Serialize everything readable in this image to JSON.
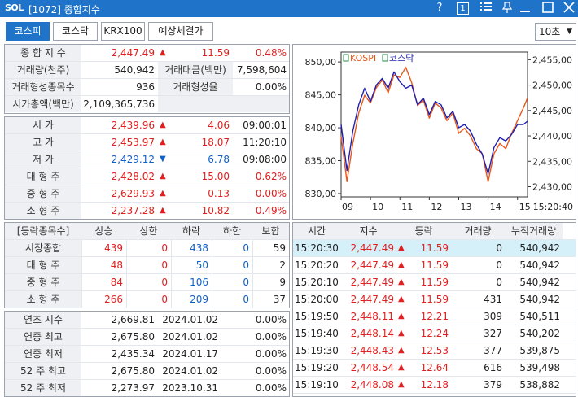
{
  "window": {
    "logo": "SOL",
    "title": "[1072] 종합지수",
    "help": "?",
    "box_label": "1"
  },
  "tabs": [
    {
      "label": "코스피",
      "active": true
    },
    {
      "label": "코스닥",
      "active": false
    },
    {
      "label": "KRX100",
      "active": false
    },
    {
      "label": "예상체결가",
      "active": false
    }
  ],
  "interval": {
    "value": "10초"
  },
  "summary": {
    "index_label": "종 합 지 수",
    "index_value": "2,447.49",
    "index_change": "11.59",
    "index_rate": "0.48%",
    "volume_label": "거래량(천주)",
    "volume_value": "540,942",
    "amount_label": "거래대금(백만)",
    "amount_value": "7,598,604",
    "formed_count_label": "거래형성종목수",
    "formed_count_value": "936",
    "formed_rate_label": "거래형성율",
    "formed_rate_value": "0.00%",
    "mcap_label": "시가총액(백만)",
    "mcap_value": "2,109,365,736"
  },
  "ohlc": [
    {
      "label": "시      가",
      "value": "2,439.96",
      "dir": "up",
      "change": "4.06",
      "extra": "09:00:01",
      "color": "red"
    },
    {
      "label": "고      가",
      "value": "2,453.97",
      "dir": "up",
      "change": "18.07",
      "extra": "11:20:10",
      "color": "red"
    },
    {
      "label": "저      가",
      "value": "2,429.12",
      "dir": "down",
      "change": "6.78",
      "extra": "09:08:00",
      "color": "blue"
    },
    {
      "label": "대 형 주",
      "value": "2,428.02",
      "dir": "up",
      "change": "15.00",
      "extra": "0.62%",
      "color": "red"
    },
    {
      "label": "중 형 주",
      "value": "2,629.93",
      "dir": "up",
      "change": "0.13",
      "extra": "0.00%",
      "color": "red"
    },
    {
      "label": "소 형 주",
      "value": "2,237.28",
      "dir": "up",
      "change": "10.82",
      "extra": "0.49%",
      "color": "red"
    }
  ],
  "breadth": {
    "headers": [
      "[등락종목수]",
      "상승",
      "상한",
      "하락",
      "하한",
      "보합"
    ],
    "rows": [
      {
        "label": "시장종합",
        "cells": [
          "439",
          "0",
          "438",
          "0",
          "59"
        ]
      },
      {
        "label": "대 형 주",
        "cells": [
          "48",
          "0",
          "50",
          "0",
          "2"
        ]
      },
      {
        "label": "중 형 주",
        "cells": [
          "84",
          "0",
          "106",
          "0",
          "9"
        ]
      },
      {
        "label": "소 형 주",
        "cells": [
          "266",
          "0",
          "209",
          "0",
          "37"
        ]
      }
    ]
  },
  "yearly": [
    {
      "label": "연초  지수",
      "value": "2,669.81",
      "date": "2024.01.02",
      "rate": "0.00%"
    },
    {
      "label": "연중  최고",
      "value": "2,675.80",
      "date": "2024.01.02",
      "rate": "0.00%"
    },
    {
      "label": "연중  최저",
      "value": "2,435.34",
      "date": "2024.01.17",
      "rate": "0.00%"
    },
    {
      "label": "52 주 최고",
      "value": "2,675.80",
      "date": "2024.01.02",
      "rate": "0.00%"
    },
    {
      "label": "52 주 최저",
      "value": "2,273.97",
      "date": "2023.10.31",
      "rate": "0.00%"
    }
  ],
  "ticks": {
    "headers": [
      "시간",
      "지수",
      "등락",
      "거래량",
      "누적거래량"
    ],
    "rows": [
      {
        "time": "15:20:30",
        "index": "2,447.49",
        "change": "11.59",
        "volume": "0",
        "cum": "540,942",
        "selected": true
      },
      {
        "time": "15:20:20",
        "index": "2,447.49",
        "change": "11.59",
        "volume": "0",
        "cum": "540,942",
        "selected": false
      },
      {
        "time": "15:20:10",
        "index": "2,447.49",
        "change": "11.59",
        "volume": "0",
        "cum": "540,942",
        "selected": false
      },
      {
        "time": "15:20:00",
        "index": "2,447.49",
        "change": "11.59",
        "volume": "431",
        "cum": "540,942",
        "selected": false
      },
      {
        "time": "15:19:50",
        "index": "2,448.11",
        "change": "12.21",
        "volume": "309",
        "cum": "540,511",
        "selected": false
      },
      {
        "time": "15:19:40",
        "index": "2,448.14",
        "change": "12.24",
        "volume": "327",
        "cum": "540,202",
        "selected": false
      },
      {
        "time": "15:19:30",
        "index": "2,448.43",
        "change": "12.53",
        "volume": "377",
        "cum": "539,875",
        "selected": false
      },
      {
        "time": "15:19:20",
        "index": "2,448.54",
        "change": "12.64",
        "volume": "616",
        "cum": "539,498",
        "selected": false
      },
      {
        "time": "15:19:10",
        "index": "2,448.08",
        "change": "12.18",
        "volume": "379",
        "cum": "538,882",
        "selected": false
      }
    ]
  },
  "chart_data": {
    "type": "line",
    "title": "",
    "series": [
      {
        "name": "KOSPI",
        "color": "#e8581a",
        "axis": "right",
        "x": [
          9.0,
          9.2,
          9.4,
          9.6,
          9.8,
          10.0,
          10.2,
          10.4,
          10.6,
          10.8,
          11.0,
          11.2,
          11.4,
          11.6,
          11.8,
          12.0,
          12.2,
          12.4,
          12.6,
          12.8,
          13.0,
          13.2,
          13.4,
          13.6,
          13.8,
          14.0,
          14.2,
          14.4,
          14.6,
          14.8,
          15.0,
          15.2,
          15.34
        ],
        "y": [
          2439.96,
          2431.0,
          2438.5,
          2444.5,
          2448.0,
          2446.5,
          2449.5,
          2451.0,
          2448.5,
          2452.0,
          2451.5,
          2453.5,
          2450.5,
          2446.0,
          2447.0,
          2443.5,
          2446.5,
          2445.5,
          2443.0,
          2444.5,
          2440.5,
          2441.5,
          2440.0,
          2437.5,
          2436.5,
          2431.0,
          2436.5,
          2438.5,
          2437.5,
          2440.5,
          2443.0,
          2445.5,
          2447.49
        ]
      },
      {
        "name": "코스닥",
        "color": "#2020b0",
        "axis": "left",
        "x": [
          9.0,
          9.2,
          9.4,
          9.6,
          9.8,
          10.0,
          10.2,
          10.4,
          10.6,
          10.8,
          11.0,
          11.2,
          11.4,
          11.6,
          11.8,
          12.0,
          12.2,
          12.4,
          12.6,
          12.8,
          13.0,
          13.2,
          13.4,
          13.6,
          13.8,
          14.0,
          14.2,
          14.4,
          14.6,
          14.8,
          15.0,
          15.2,
          15.34
        ],
        "y": [
          840.5,
          833.5,
          839.5,
          843.5,
          846.0,
          844.0,
          846.5,
          847.5,
          846.0,
          848.5,
          847.0,
          846.0,
          846.5,
          843.5,
          844.5,
          842.0,
          844.0,
          843.5,
          841.5,
          842.5,
          840.0,
          840.5,
          839.5,
          837.5,
          836.0,
          833.0,
          837.0,
          838.5,
          838.0,
          839.0,
          840.5,
          840.5,
          841.0
        ]
      }
    ],
    "y_left": {
      "ticks": [
        "850,00",
        "845,00",
        "840,00",
        "835,00",
        "830,00"
      ],
      "range": [
        829.5,
        851.5
      ]
    },
    "y_right": {
      "ticks": [
        "2,455,00",
        "2,450,00",
        "2,445,00",
        "2,440,00",
        "2,435,00",
        "2,430,00"
      ],
      "range": [
        2428.0,
        2456.5
      ]
    },
    "x_axis": {
      "ticks": [
        "09",
        "10",
        "11",
        "12",
        "13",
        "14",
        "15"
      ],
      "range": [
        9.0,
        15.34
      ],
      "end_label": "15:20:40"
    },
    "legend": "top-left",
    "grid": false
  }
}
